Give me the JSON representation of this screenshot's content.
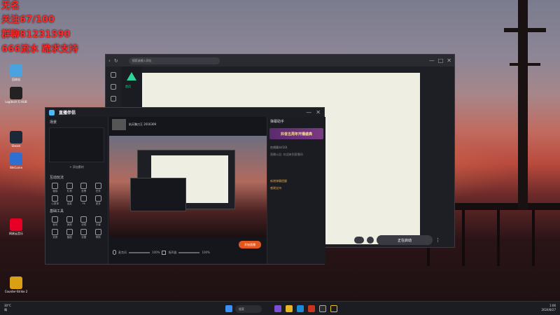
{
  "overlay": {
    "line1": "无名",
    "line2": "关注67/100",
    "line3": "群聊81231590",
    "line4": "666流水 跪求支持"
  },
  "desktop_icons": [
    {
      "label": "回收站",
      "icon": "recycle-bin-icon",
      "color": "#4aa3df"
    },
    {
      "label": "Logitech G HUB",
      "icon": "logitech-icon",
      "color": "#222222"
    },
    {
      "label": "Steam",
      "icon": "steam-icon",
      "color": "#1b2838"
    },
    {
      "label": "WeGame",
      "icon": "wegame-icon",
      "color": "#2f6fd1"
    },
    {
      "label": "网易云音乐",
      "icon": "netease-music-icon",
      "color": "#e60026"
    },
    {
      "label": "Counter-Strike 2",
      "icon": "cs2-icon",
      "color": "#d9a016"
    }
  ],
  "browser": {
    "url_placeholder": "搜索或输入网址",
    "nav_label": "首页",
    "start_label": "正在启动"
  },
  "app": {
    "brand": "直播伴侣",
    "user": "杭天胸刀王 2016309",
    "scene_title": "场景",
    "sections": [
      {
        "title": "互动玩法",
        "items": [
          "福袋",
          "礼物",
          "投票",
          "任务",
          "心愿单",
          "连麦",
          "PK",
          "更多"
        ]
      },
      {
        "title": "基础工具",
        "items": [
          "音效",
          "美颜",
          "滤镜",
          "字幕",
          "录屏",
          "截图",
          "设置",
          "帮助"
        ]
      }
    ],
    "add_scene": "+ 添加素材",
    "mic_label": "麦克风",
    "speaker_label": "扬声器",
    "mic_pct": "100%",
    "speaker_pct": "100%",
    "go_live": "开始直播",
    "chat_tab": "弹幕助手",
    "banner": "抖音五周年开播盛典",
    "chat_lines": [
      "在线观众(10)",
      "直播公告: 欢迎来到直播间",
      "新增弹幕提醒",
      "感谢支持"
    ]
  },
  "taskbar": {
    "weather": "30°C",
    "weather_desc": "晴",
    "search": "搜索",
    "time": "1:06",
    "date": "2024/8/27"
  }
}
